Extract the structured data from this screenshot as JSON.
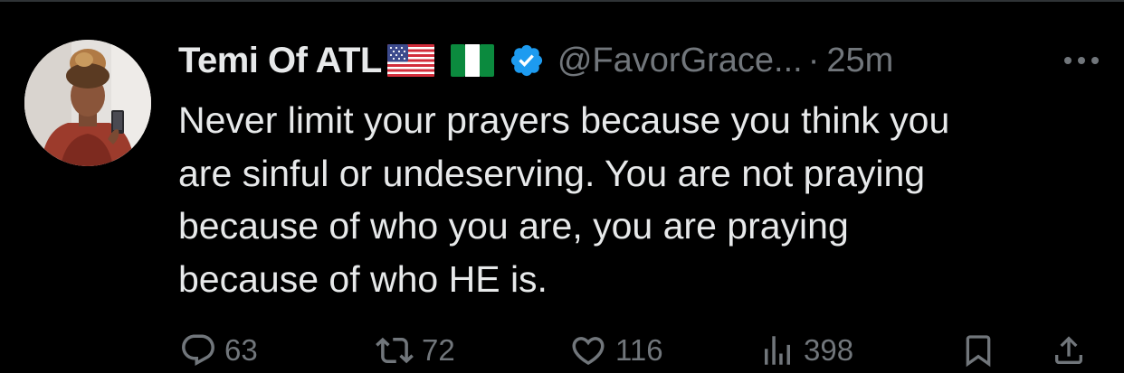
{
  "tweet": {
    "author": {
      "display_name": "Temi Of ATL",
      "flags": [
        "us-flag-icon",
        "nigeria-flag-icon"
      ],
      "verified": true,
      "handle": "@FavorGrace...",
      "avatar": "avatar"
    },
    "separator": "·",
    "timestamp": "25m",
    "text_lines": [
      "Never limit your prayers because you think you",
      "are sinful or undeserving. You are not praying",
      "because of who you are, you are praying",
      "because of who HE is."
    ],
    "actions": {
      "reply": {
        "icon": "reply-icon",
        "count": "63"
      },
      "retweet": {
        "icon": "retweet-icon",
        "count": "72"
      },
      "like": {
        "icon": "like-icon",
        "count": "116"
      },
      "views": {
        "icon": "views-icon",
        "count": "398"
      },
      "bookmark": {
        "icon": "bookmark-icon"
      },
      "share": {
        "icon": "share-icon"
      }
    },
    "more": {
      "icon": "more-icon"
    }
  },
  "colors": {
    "background": "#000000",
    "text_primary": "#e7e9ea",
    "text_secondary": "#71767b",
    "verified_blue": "#1d9bf0",
    "divider": "#2f3336"
  }
}
